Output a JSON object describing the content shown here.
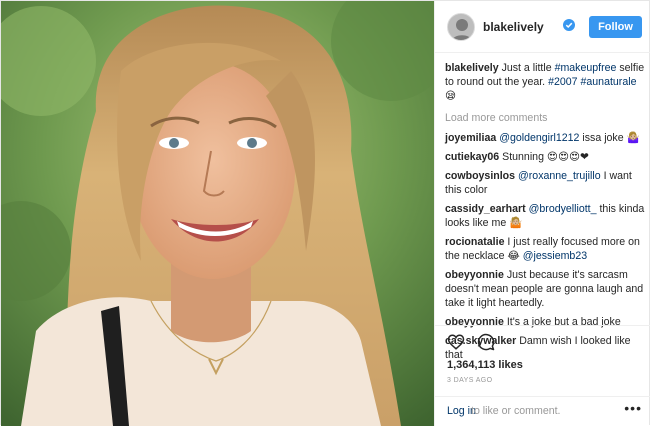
{
  "header": {
    "username": "blakelively",
    "follow_label": "Follow"
  },
  "caption": {
    "user": "blakelively",
    "text": "Just a little",
    "hashtag1": "#makeupfree",
    "text2": "selfie to round out the year.",
    "hashtag2": "#2007",
    "hashtag3": "#aunaturale",
    "emoji": "😪"
  },
  "load_more": "Load more comments",
  "comments": [
    {
      "user": "joyemiliaa",
      "mention": "@goldengirl1212",
      "text": "issa joke 🤷🏼‍♀️"
    },
    {
      "user": "cutiekay06",
      "mention": "",
      "text": "Stunning 😍😍😍❤"
    },
    {
      "user": "cowboysinlos",
      "mention": "@roxanne_trujillo",
      "text": "I want this color"
    },
    {
      "user": "cassidy_earhart",
      "mention": "@brodyelliott_",
      "text": "this kinda looks like me 🤷🏼"
    },
    {
      "user": "rocionatalie",
      "mention": "",
      "text": "I just really focused more on the necklace 😂",
      "mention_after": "@jessiemb23"
    },
    {
      "user": "obeyyonnie",
      "mention": "",
      "text": "Just because it's sarcasm doesn't mean people are gonna laugh and take it light heartedly."
    },
    {
      "user": "obeyyonnie",
      "mention": "",
      "text": "It's a joke but a bad joke"
    },
    {
      "user": "cas.skywalker",
      "mention": "",
      "text": "Damn wish I looked like that"
    }
  ],
  "actions": {
    "likes": "1,364,113 likes",
    "time_ago": "3 DAYS AGO",
    "login_link": "Log in",
    "login_rest": "to like or comment.",
    "more": "•••"
  },
  "icons": {
    "like": "heart-outline-icon",
    "comment": "comment-bubble-icon",
    "verified": "verified-badge-icon",
    "more": "more-options-icon"
  },
  "colors": {
    "follow": "#3897f0",
    "link": "#003569",
    "muted": "#999999"
  }
}
